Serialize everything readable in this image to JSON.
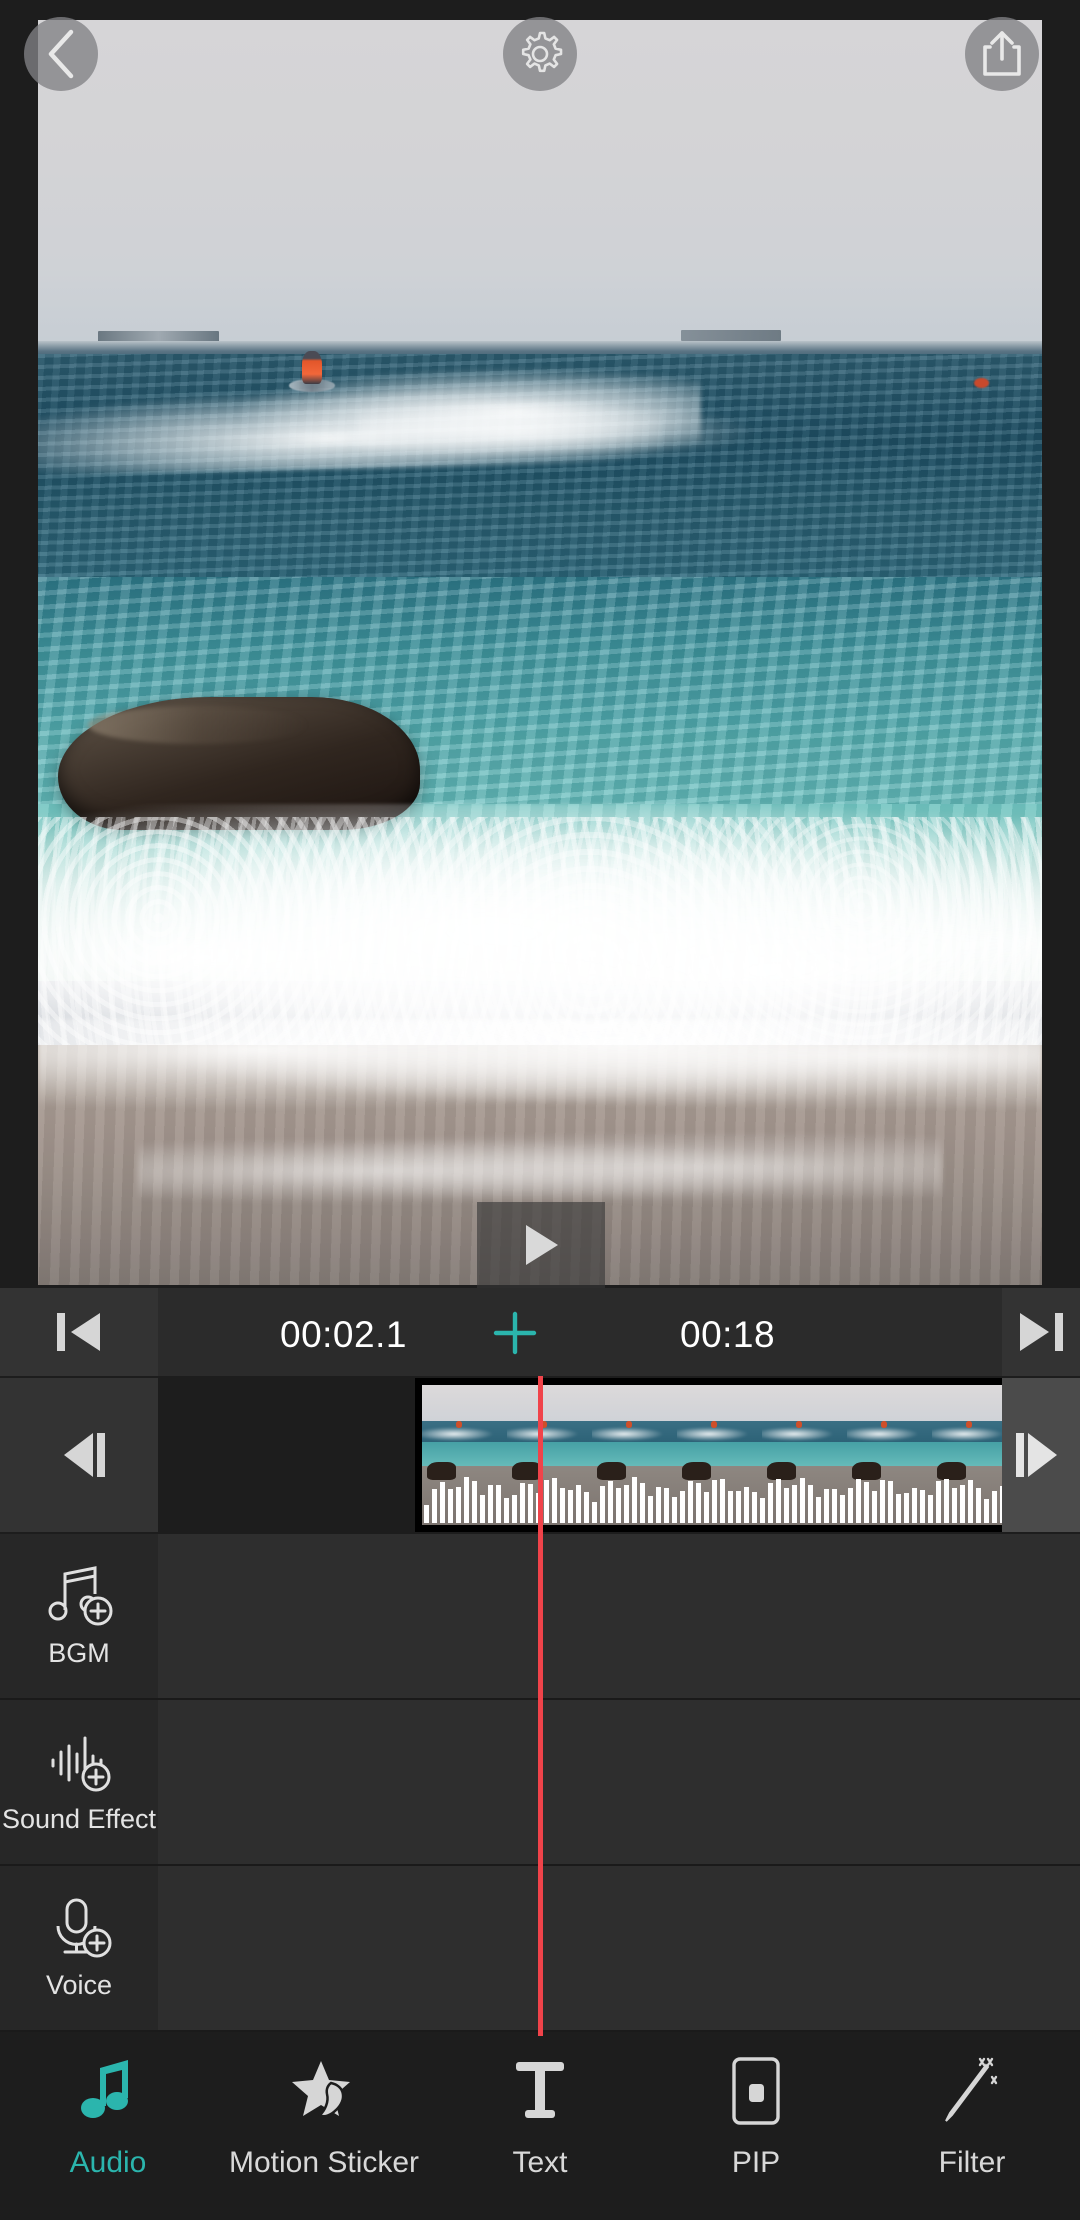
{
  "app": {
    "accent_color": "#2bb5ad",
    "playhead_color": "#f0434a",
    "background": "#1d1d1d"
  },
  "preview": {
    "back_icon": "chevron-left-icon",
    "settings_icon": "gear-icon",
    "share_icon": "share-upload-icon",
    "play_icon": "play-triangle-icon",
    "scene_description": "Jet ski rider on ocean waves breaking over a rock onto sandy beach"
  },
  "timeline": {
    "current_time": "00:02.1",
    "total_duration": "00:18",
    "add_clip_icon": "plus-icon",
    "skip_to_start_icon": "skip-to-start-icon",
    "skip_to_end_icon": "skip-to-end-icon",
    "step_back_icon": "step-back-frame-icon",
    "step_forward_icon": "step-forward-frame-icon",
    "clip_selected": true
  },
  "tracks": [
    {
      "label": "BGM",
      "icon": "music-note-plus-icon"
    },
    {
      "label": "Sound Effect",
      "icon": "waveform-plus-icon"
    },
    {
      "label": "Voice",
      "icon": "microphone-plus-icon"
    }
  ],
  "bottom_nav": {
    "active_index": 0,
    "items": [
      {
        "label": "Audio",
        "icon": "music-note-icon"
      },
      {
        "label": "Motion Sticker",
        "icon": "star-sticker-icon"
      },
      {
        "label": "Text",
        "icon": "text-t-icon"
      },
      {
        "label": "PIP",
        "icon": "picture-in-picture-icon"
      },
      {
        "label": "Filter",
        "icon": "magic-wand-icon"
      }
    ]
  }
}
